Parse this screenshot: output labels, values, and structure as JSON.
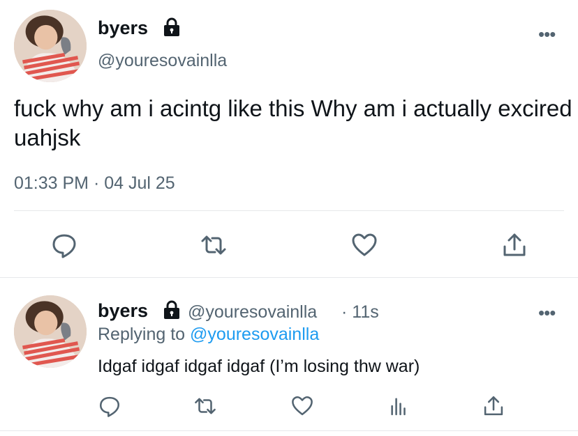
{
  "main_tweet": {
    "display_name": "byers",
    "handle": "@youresovainlla",
    "text": "fuck why am i acintg like this Why am i actually excired uahjsk",
    "timestamp": "01:33 PM · 04 Jul 25",
    "more_label": "•••",
    "actions": [
      "reply-icon",
      "retweet-icon",
      "like-icon",
      "share-icon"
    ]
  },
  "reply_tweet": {
    "display_name": "byers",
    "handle": "@youresovainlla",
    "time": "· 11s",
    "replying_label": "Replying to",
    "replying_to": "@youresovainlla",
    "text": "Idgaf idgaf idgaf idgaf (I’m losing thw war)",
    "more_label": "•••",
    "actions": [
      "reply-icon",
      "retweet-icon",
      "like-icon",
      "analytics-icon",
      "share-icon"
    ]
  },
  "colors": {
    "text": "#0f1419",
    "muted": "#536471",
    "link": "#1d9bf0",
    "divider": "#e6e8ea"
  }
}
